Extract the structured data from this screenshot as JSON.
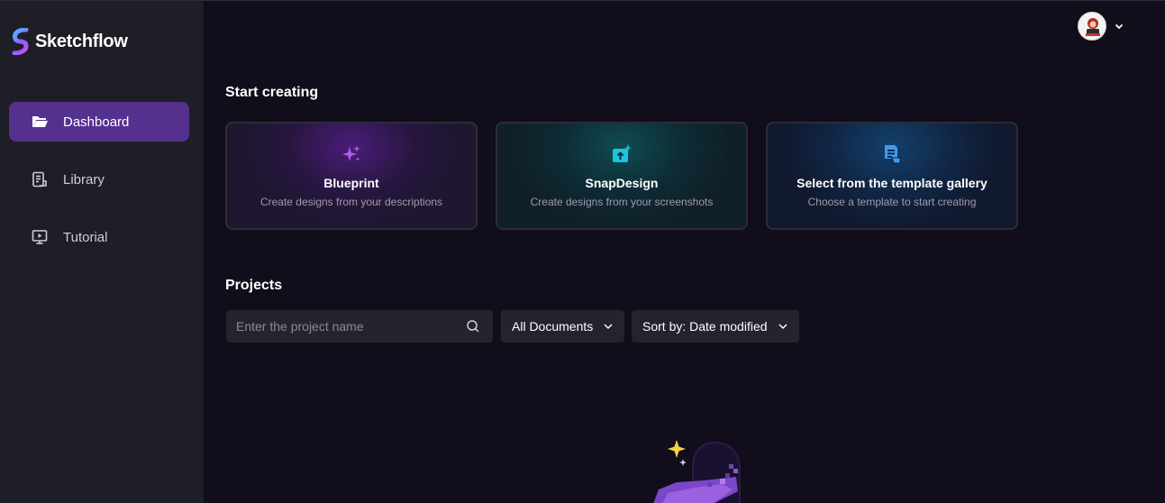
{
  "app": {
    "name": "Sketchflow"
  },
  "sidebar": {
    "items": [
      {
        "label": "Dashboard",
        "icon": "folder-open-icon",
        "active": true
      },
      {
        "label": "Library",
        "icon": "library-icon",
        "active": false
      },
      {
        "label": "Tutorial",
        "icon": "monitor-play-icon",
        "active": false
      }
    ]
  },
  "header": {
    "avatar_icon": "user-avatar",
    "menu_icon": "chevron-down-icon"
  },
  "start_creating": {
    "title": "Start creating",
    "cards": [
      {
        "title": "Blueprint",
        "description": "Create designs from your descriptions",
        "icon": "sparkles-icon",
        "accent": "#b45cf0"
      },
      {
        "title": "SnapDesign",
        "description": "Create designs from your screenshots",
        "icon": "image-upload-icon",
        "accent": "#19c6dc"
      },
      {
        "title": "Select from the template gallery",
        "description": "Choose a template to start creating",
        "icon": "document-template-icon",
        "accent": "#3f9bf0"
      }
    ]
  },
  "projects": {
    "title": "Projects",
    "search": {
      "placeholder": "Enter the project name",
      "value": ""
    },
    "filter": {
      "selected": "All Documents"
    },
    "sort": {
      "selected": "Sort by: Date modified"
    }
  },
  "colors": {
    "sidebar_bg": "#1e1e27",
    "main_bg": "#110d1a",
    "active_nav": "#55318f",
    "control_bg": "#24232e"
  }
}
